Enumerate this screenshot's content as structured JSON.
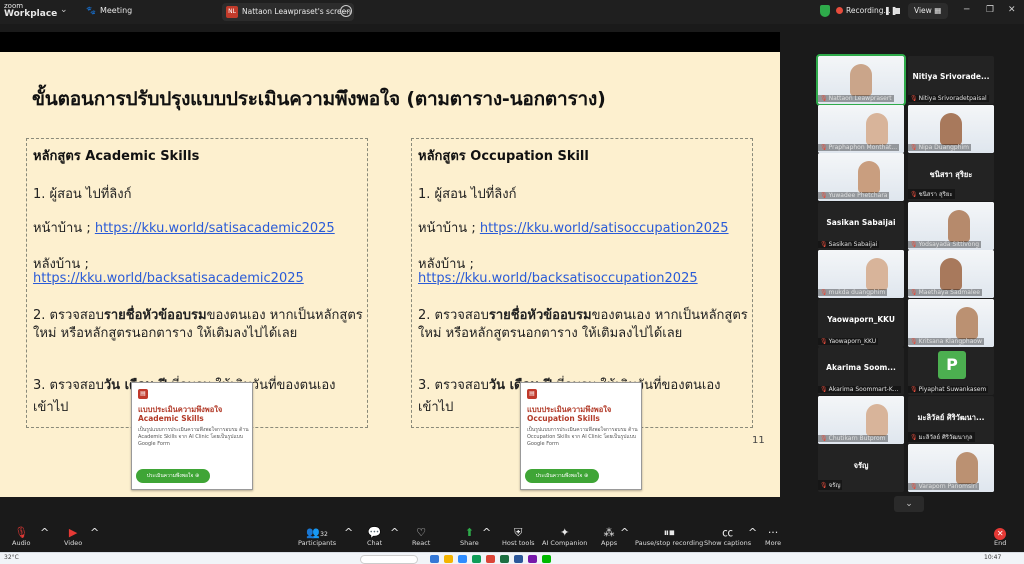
{
  "app": {
    "logo_line1": "zoom",
    "logo_line2": "Workplace",
    "meeting_tab": "Meeting",
    "screen_tab": "Nattaon Leawpraset's screen",
    "screen_tab_badge": "NL",
    "recording_label": "Recording...",
    "view_label": "View"
  },
  "slide": {
    "title": "ขั้นตอนการปรับปรุงแบบประเมินความพึงพอใจ (ตามตาราง-นอกตาราง)",
    "page_number": "11",
    "left": {
      "heading": "หลักสูตร Academic Skills",
      "step1": "1. ผู้สอน ไปที่ลิงก์",
      "home_prefix": "หน้าบ้าน ; ",
      "home_link": "https://kku.world/satisacademic2025",
      "back_prefix": "หลังบ้าน ;",
      "back_link": "https://kku.world/backsatisacademic2025",
      "step2_a": "2. ตรวจสอบ",
      "step2_b": "รายชื่อหัวข้ออบรม",
      "step2_c": "ของตนเอง หากเป็นหลักสูตรใหม่ หรือหลักสูตรนอกตาราง ให้เติมลงไปได้เลย",
      "step3_a": "3. ตรวจสอบ",
      "step3_b": "วัน เดือน ปี",
      "step3_c": " ที่อบรม ให้เติมวันที่ของตนเองเข้าไป",
      "card_title": "แบบประเมินความพึงพอใจ Academic Skills",
      "card_desc": "เป็นรูปแบบการประเมินความพึงพอใจการอบรม ด้าน Academic Skills จาก AI Clinic โดยเป็นรูปแบบ Google Form",
      "card_button": "ประเมินความพึงพอใจ ⊕"
    },
    "right": {
      "heading": "หลักสูตร Occupation Skill",
      "step1": "1. ผู้สอน ไปที่ลิงก์",
      "home_prefix": "หน้าบ้าน ; ",
      "home_link": "https://kku.world/satisoccupation2025",
      "back_prefix": "หลังบ้าน ;",
      "back_link": "https://kku.world/backsatisoccupation2025",
      "step2_a": "2. ตรวจสอบ",
      "step2_b": "รายชื่อหัวข้ออบรม",
      "step2_c": "ของตนเอง หากเป็นหลักสูตรใหม่ หรือหลักสูตรนอกตาราง ให้เติมลงไปได้เลย",
      "step3_a": "3. ตรวจสอบ",
      "step3_b": "วัน เดือน ปี",
      "step3_c": " ที่อบรม ให้เติมวันที่ของตนเองเข้าไป",
      "card_title": "แบบประเมินความพึงพอใจ Occupation Skills",
      "card_desc": "เป็นรูปแบบการประเมินความพึงพอใจการอบรม ด้าน Occupation Skills จาก AI Clinic โดยเป็นรูปแบบ Google Form",
      "card_button": "ประเมินความพึงพอใจ ⊕"
    }
  },
  "participants": [
    {
      "name": "Nattaon Leawprasert",
      "kind": "video",
      "label": ""
    },
    {
      "name": "Nitiya Srivoradetpaisal",
      "kind": "name",
      "label": "Nitiya Srivorade..."
    },
    {
      "name": "Praphaphon Monthat...",
      "kind": "video",
      "label": ""
    },
    {
      "name": "Nipa Duangphim",
      "kind": "video",
      "label": ""
    },
    {
      "name": "Yuwadee Phetchara",
      "kind": "video",
      "label": ""
    },
    {
      "name": "ชนิสรา สุริยะ",
      "kind": "name",
      "label": "ชนิสรา สุริยะ"
    },
    {
      "name": "Sasikan Sabaijai",
      "kind": "name",
      "label": "Sasikan Sabaijai"
    },
    {
      "name": "Yodsayada Sittivong",
      "kind": "video",
      "label": ""
    },
    {
      "name": "mukda duangphim",
      "kind": "video",
      "label": ""
    },
    {
      "name": "Maethaya Sadmalee",
      "kind": "video",
      "label": ""
    },
    {
      "name": "Yaowaporn_KKU",
      "kind": "name",
      "label": "Yaowaporn_KKU"
    },
    {
      "name": "Kritsana Klangphaow",
      "kind": "video",
      "label": ""
    },
    {
      "name": "Akarima Soommart-K...",
      "kind": "name",
      "label": "Akarima Soom..."
    },
    {
      "name": "Piyaphat Suwankasem",
      "kind": "avatar",
      "label": "P"
    },
    {
      "name": "Chutikarn Butprom",
      "kind": "video",
      "label": ""
    },
    {
      "name": "มะลิวัลย์ ศิริวัฒนากุล",
      "kind": "name",
      "label": "มะลิวัลย์ ศิริวัฒนา..."
    },
    {
      "name": "จรัญ",
      "kind": "name",
      "label": "จรัญ"
    },
    {
      "name": "Varaporn Panomsiri",
      "kind": "video",
      "label": ""
    }
  ],
  "toolbar": {
    "audio": "Audio",
    "video": "Video",
    "participants": "Participants",
    "participants_count": "32",
    "chat": "Chat",
    "react": "React",
    "share": "Share",
    "host_tools": "Host tools",
    "ai_companion": "AI Companion",
    "apps": "Apps",
    "pause_stop": "Pause/stop recording",
    "show_captions": "Show captions",
    "more": "More",
    "end": "End"
  },
  "taskbar": {
    "weather": "32°C",
    "clock": "10:47"
  },
  "colors": {
    "slide_bg": "#fdf0cf",
    "link": "#2a5bd7",
    "recording": "#e74c3c",
    "end": "#e53935",
    "share": "#2eaa4a"
  }
}
